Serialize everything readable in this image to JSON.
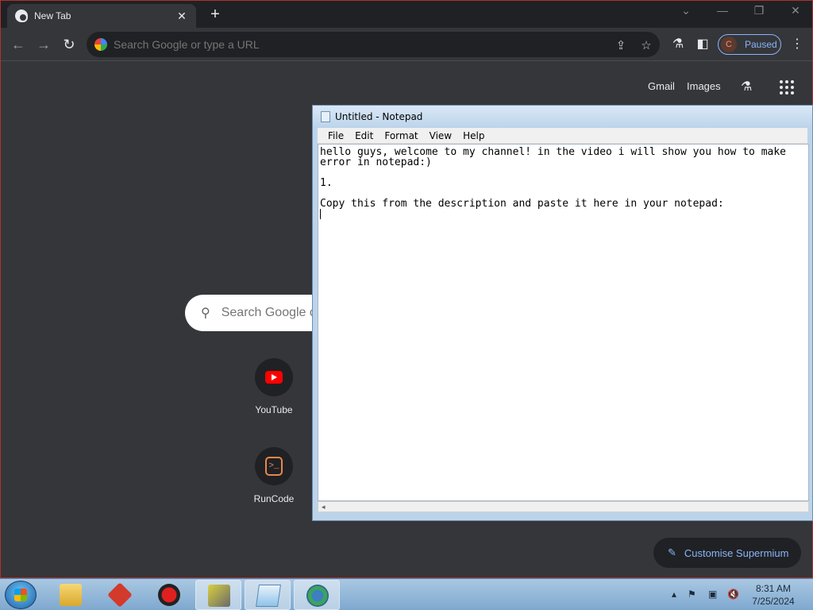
{
  "browser": {
    "tab_title": "New Tab",
    "omnibox_placeholder": "Search Google or type a URL",
    "profile_initial": "C",
    "profile_status": "Paused"
  },
  "ntp": {
    "gmail": "Gmail",
    "images": "Images",
    "search_placeholder": "Search Google or type a URL",
    "shortcuts": [
      {
        "label": "YouTube"
      },
      {
        "label": "RunCode"
      }
    ],
    "customise_label": "Customise Supermium"
  },
  "notepad": {
    "title": "Untitled - Notepad",
    "menu": [
      "File",
      "Edit",
      "Format",
      "View",
      "Help"
    ],
    "content": "hello guys, welcome to my channel! in the video i will show you how to make\nerror in notepad:)\n\n1.\n\nCopy this from the description and paste it here in your notepad:\n"
  },
  "taskbar": {
    "time": "8:31 AM",
    "date": "7/25/2024"
  },
  "colors": {
    "browser_bg": "#35363a",
    "tabstrip_bg": "#202124",
    "accent_blue": "#8ab4f8",
    "youtube_red": "#ff0000",
    "runcode_orange": "#e8874d"
  }
}
